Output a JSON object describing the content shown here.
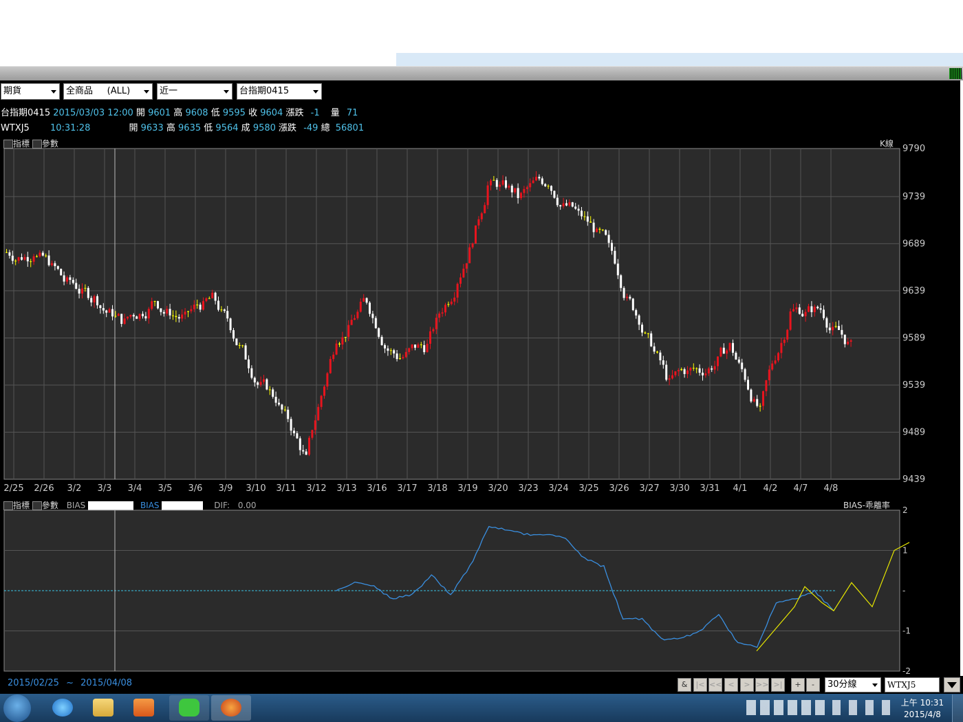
{
  "toolbar": {
    "combo1": "期貨",
    "combo2": "全商品     (ALL)",
    "combo3": "近一",
    "combo4": "台指期0415"
  },
  "quote1": {
    "name": "台指期0415",
    "datetime": "2015/03/03 12:00",
    "open_label": "開",
    "open": "9601",
    "high_label": "高",
    "high": "9608",
    "low_label": "低",
    "low": "9595",
    "close_label": "收",
    "close": "9604",
    "chg_label": "漲跌",
    "chg": "-1",
    "vol_label": "量",
    "vol": "71"
  },
  "quote2": {
    "name": "WTXJ5",
    "time": "10:31:28",
    "open_label": "開",
    "open": "9633",
    "high_label": "高",
    "high": "9635",
    "low_label": "低",
    "low": "9564",
    "last_label": "成",
    "last": "9580",
    "chg_label": "漲跌",
    "chg": "-49",
    "total_label": "總",
    "total": "56801"
  },
  "panel1": {
    "indicator_label": "指標",
    "param_label": "參數",
    "type_label": "K線"
  },
  "panel2": {
    "indicator_label": "指標",
    "param_label": "參數",
    "bias1_label": "BIAS",
    "bias2_label": "BIAS",
    "dif_label": "DIF:",
    "dif_value": "0.00",
    "type_label": "BIAS-乖離率"
  },
  "range": {
    "start": "2015/02/25",
    "sep": "~",
    "end": "2015/04/08"
  },
  "nav": {
    "amp": "&",
    "first": "|<",
    "prev_page": "<<",
    "prev": "<",
    "next": ">",
    "next_page": ">>",
    "last": ">|",
    "plus": "+",
    "minus": "-",
    "interval": "30分線",
    "symbol": "WTXJ5"
  },
  "taskbar": {
    "time": "上午 10:31",
    "date": "2015/4/8"
  },
  "colors": {
    "up": "#e8141e",
    "down": "#ffffff",
    "doji": "#ffff00",
    "bias": "#3a8fe0",
    "signal": "#e6e600",
    "zero": "#3ac6e6",
    "grid": "#555555",
    "plot_bg": "#2b2b2b"
  },
  "chart_data": [
    {
      "type": "candlestick",
      "categories": [
        "2/25",
        "2/26",
        "3/2",
        "3/3",
        "3/4",
        "3/5",
        "3/6",
        "3/9",
        "3/10",
        "3/11",
        "3/12",
        "3/13",
        "3/16",
        "3/17",
        "3/18",
        "3/19",
        "3/20",
        "3/23",
        "3/24",
        "3/25",
        "3/26",
        "3/27",
        "3/30",
        "3/31",
        "4/1",
        "4/2",
        "4/7",
        "4/8"
      ],
      "y_ticks": [
        9790,
        9739,
        9689,
        9639,
        9589,
        9539,
        9489,
        9439
      ],
      "ylim": [
        9439,
        9790
      ],
      "approx_close_by_day": [
        9680,
        9650,
        9630,
        9605,
        9630,
        9610,
        9630,
        9570,
        9525,
        9460,
        9590,
        9630,
        9570,
        9580,
        9650,
        9750,
        9740,
        9755,
        9720,
        9685,
        9610,
        9540,
        9555,
        9580,
        9510,
        9615,
        9620,
        9580
      ]
    },
    {
      "type": "line",
      "title": "BIAS-乖離率",
      "y_ticks": [
        2,
        1,
        0,
        -1,
        -2
      ],
      "ylim": [
        -2,
        2
      ],
      "series": [
        {
          "name": "BIAS",
          "values": [
            0.0,
            0.2,
            0.1,
            -0.2,
            -0.1,
            0.4,
            -0.1,
            0.6,
            1.6,
            1.5,
            1.4,
            1.4,
            1.3,
            0.8,
            0.6,
            -0.7,
            -0.7,
            -1.2,
            -1.2,
            -1.0,
            -0.6,
            -1.3,
            -1.4,
            -0.3,
            -0.2,
            0.0,
            -0.5
          ]
        },
        {
          "name": "signal",
          "values": [
            -1.5,
            -0.9,
            -0.4,
            0.1,
            -0.3,
            -0.5,
            0.2,
            -0.4,
            1.0,
            1.2
          ]
        }
      ]
    }
  ]
}
